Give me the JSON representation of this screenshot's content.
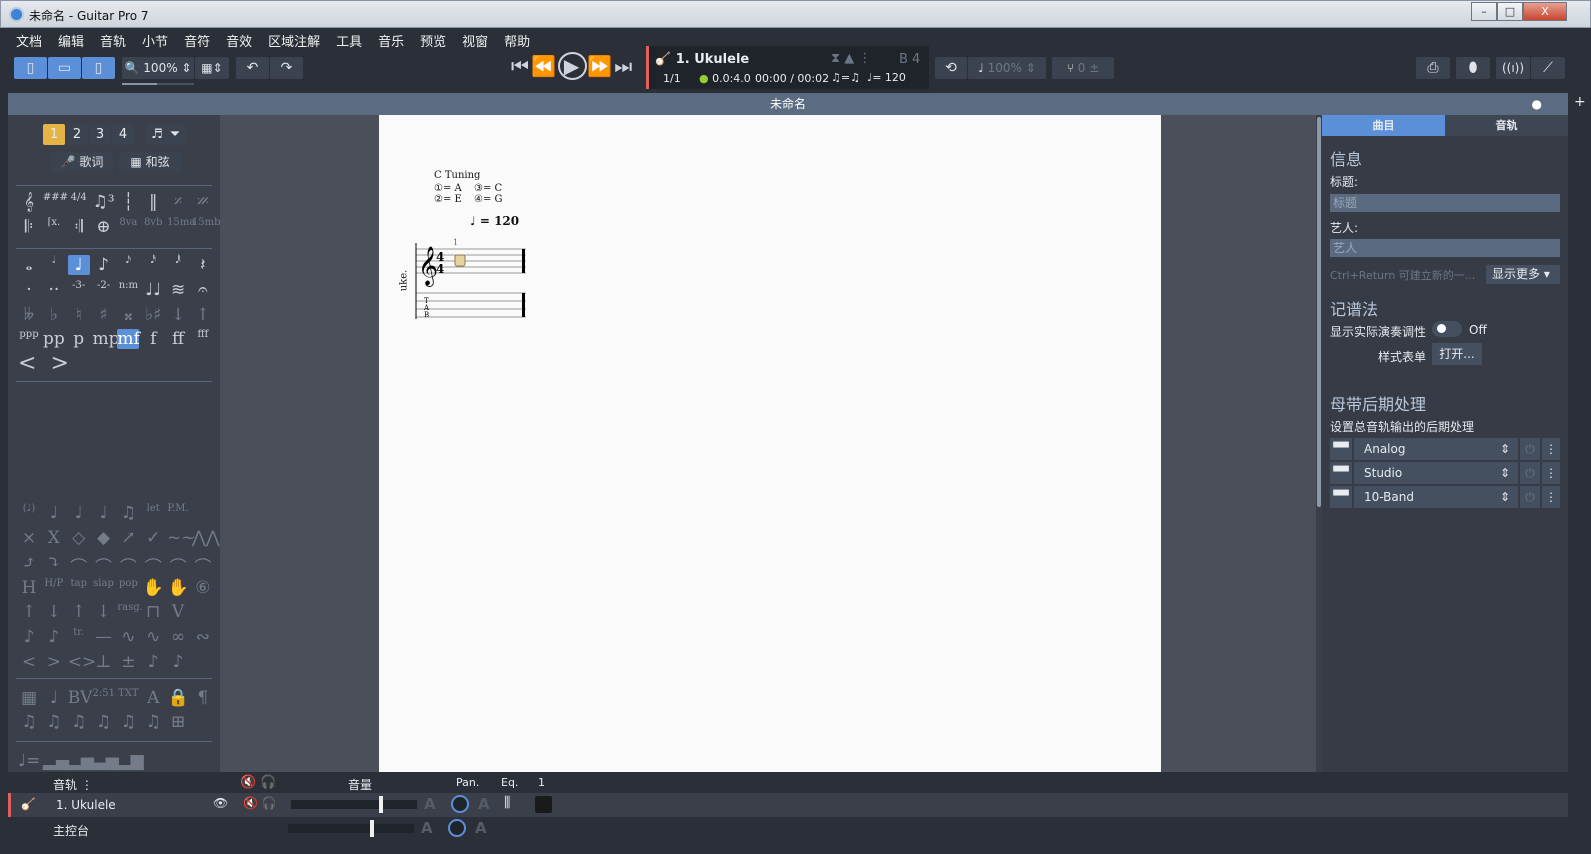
{
  "window": {
    "title": "未命名 - Guitar Pro 7",
    "minimize": "–",
    "maximize": "□",
    "close": "X"
  },
  "menu": [
    "文档",
    "编辑",
    "音轨",
    "小节",
    "音符",
    "音效",
    "区域注解",
    "工具",
    "音乐",
    "预览",
    "视窗",
    "帮助"
  ],
  "toolbar": {
    "zoom": "100%",
    "undo": "↶",
    "redo": "↷"
  },
  "transport": {
    "track": "1. Ukulele",
    "bar": "1/1",
    "position": "0.0:4.0",
    "time": "00:00 / 00:02",
    "swing": "♫=♫",
    "tempo": "♩= 120",
    "key": "B 4",
    "speed": "100%",
    "tuning_value": "0"
  },
  "document": {
    "tab_title": "未命名"
  },
  "palette": {
    "voices": [
      "1",
      "2",
      "3",
      "4"
    ],
    "lyrics": "歌词",
    "chords": "和弦",
    "rows": [
      [
        "𝄞",
        "###",
        "4/4",
        "♫³",
        "┆",
        "‖",
        "𝄎",
        "𝄏"
      ],
      [
        "𝄆",
        "⌈x.",
        "𝄇",
        "⊕",
        "8va",
        "8vb",
        "15ma",
        "15mb"
      ],
      [
        "𝅝",
        "𝅗𝅥",
        "♩",
        "♪",
        "𝅘𝅥𝅯",
        "𝅘𝅥𝅰",
        "𝅘𝅥𝅱",
        "𝄽"
      ],
      [
        "·",
        "··",
        "-3-",
        "-2-",
        "n:m",
        "♩♩",
        "≋",
        "𝄐"
      ],
      [
        "𝄫",
        "♭",
        "♮",
        "♯",
        "𝄪",
        "♭♯",
        "↓",
        "↑"
      ],
      [
        "ppp",
        "pp",
        "p",
        "mp",
        "mf",
        "f",
        "ff",
        "fff"
      ],
      [
        "(♩)",
        "♩",
        "♩",
        "♩",
        "♫",
        "let",
        "P.M.",
        " "
      ],
      [
        "×",
        "X",
        "◇",
        "◆",
        "↗",
        "✓",
        "~~",
        "⋀⋀"
      ],
      [
        "⤴",
        "⤵",
        "⌒",
        "⌒",
        "⌒",
        "⌒",
        "⌒",
        "⌒"
      ],
      [
        "H",
        "H/P",
        "tap",
        "slap",
        "pop",
        "✋",
        "✋",
        "⑥"
      ],
      [
        "↑",
        "↓",
        "↑",
        "↓",
        "rasg.",
        "⊓",
        "V",
        " "
      ],
      [
        "♪",
        "♪",
        "tr.",
        "—",
        "∿",
        "∿",
        "∞",
        "∾"
      ],
      [
        "<",
        ">",
        "<>",
        "⊥",
        "±",
        "♪",
        "♪",
        " "
      ],
      [
        "▦",
        "♩",
        "BV",
        "2:51",
        "TXT",
        "A",
        "🔒",
        "¶"
      ],
      [
        "♫",
        "♫",
        "♫",
        "♫",
        "♫",
        "♫",
        "⊞",
        " "
      ],
      [
        "♩=",
        "▂▄",
        "▂▅",
        "▃▅",
        "▂▆",
        " ",
        " ",
        " "
      ]
    ]
  },
  "score": {
    "tuning_title": "C Tuning",
    "strings": [
      "①= A",
      "③= C",
      "②= E",
      "④= G"
    ],
    "tempo": "♩ = 120",
    "bar_number": "1",
    "track_short": "uke.",
    "tab_letters": "T A B"
  },
  "right_panel": {
    "tabs": [
      "曲目",
      "音轨"
    ],
    "info_heading": "信息",
    "title_label": "标题:",
    "title_placeholder": "标题",
    "artist_label": "艺人:",
    "artist_placeholder": "艺人",
    "hint": "Ctrl+Return 可建立新的一...",
    "show_more": "显示更多 ▾",
    "notation_heading": "记谱法",
    "transpose_label": "显示实际演奏调性",
    "transpose_state": "Off",
    "stylesheet_label": "样式表单",
    "stylesheet_button": "打开...",
    "mastering_heading": "母带后期处理",
    "mastering_desc": "设置总音轨输出的后期处理",
    "effects": [
      "Analog",
      "Studio",
      "10-Band"
    ]
  },
  "tracks": {
    "header": "音轨",
    "volume": "音量",
    "pan": "Pan.",
    "eq": "Eq.",
    "bar": "1",
    "rows": [
      {
        "name": "1. Ukulele"
      },
      {
        "name": "主控台"
      }
    ],
    "volume_level": 0.7,
    "accent": "#e06060"
  },
  "colors": {
    "accent": "#5b8fd8",
    "voice1": "#e5b444"
  }
}
